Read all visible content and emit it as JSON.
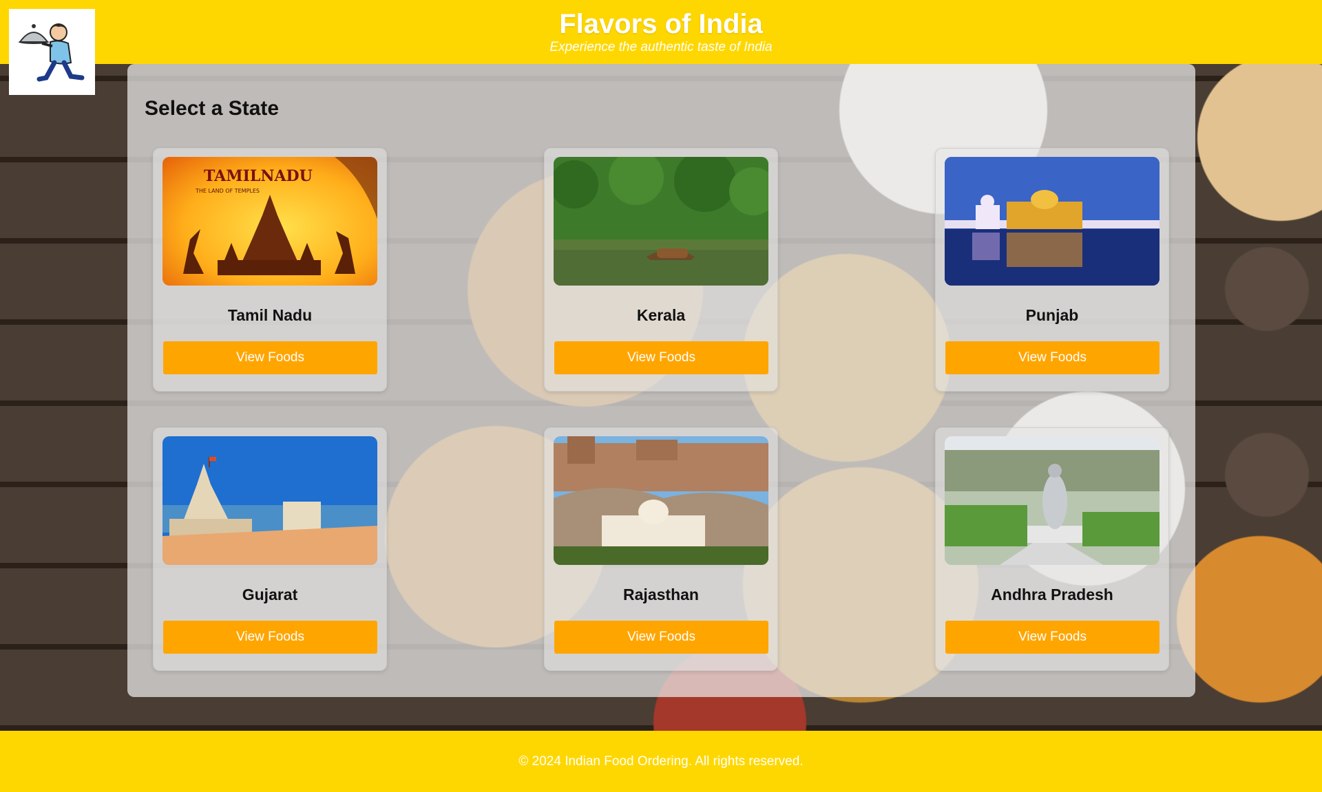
{
  "header": {
    "title": "Flavors of India",
    "subtitle": "Experience the authentic taste of India",
    "logo_icon": "waiter-with-cloche-icon"
  },
  "main": {
    "heading": "Select a State",
    "states": [
      {
        "name": "Tamil Nadu",
        "button_label": "View Foods",
        "image_text_1": "TAMILNADU",
        "image_text_2": "THE LAND OF TEMPLES"
      },
      {
        "name": "Kerala",
        "button_label": "View Foods"
      },
      {
        "name": "Punjab",
        "button_label": "View Foods"
      },
      {
        "name": "Gujarat",
        "button_label": "View Foods"
      },
      {
        "name": "Rajasthan",
        "button_label": "View Foods"
      },
      {
        "name": "Andhra Pradesh",
        "button_label": "View Foods"
      }
    ]
  },
  "footer": {
    "text": "© 2024 Indian Food Ordering. All rights reserved."
  },
  "colors": {
    "header_bg": "#ffd700",
    "button_bg": "#ffa500",
    "button_text": "#ffffff"
  }
}
